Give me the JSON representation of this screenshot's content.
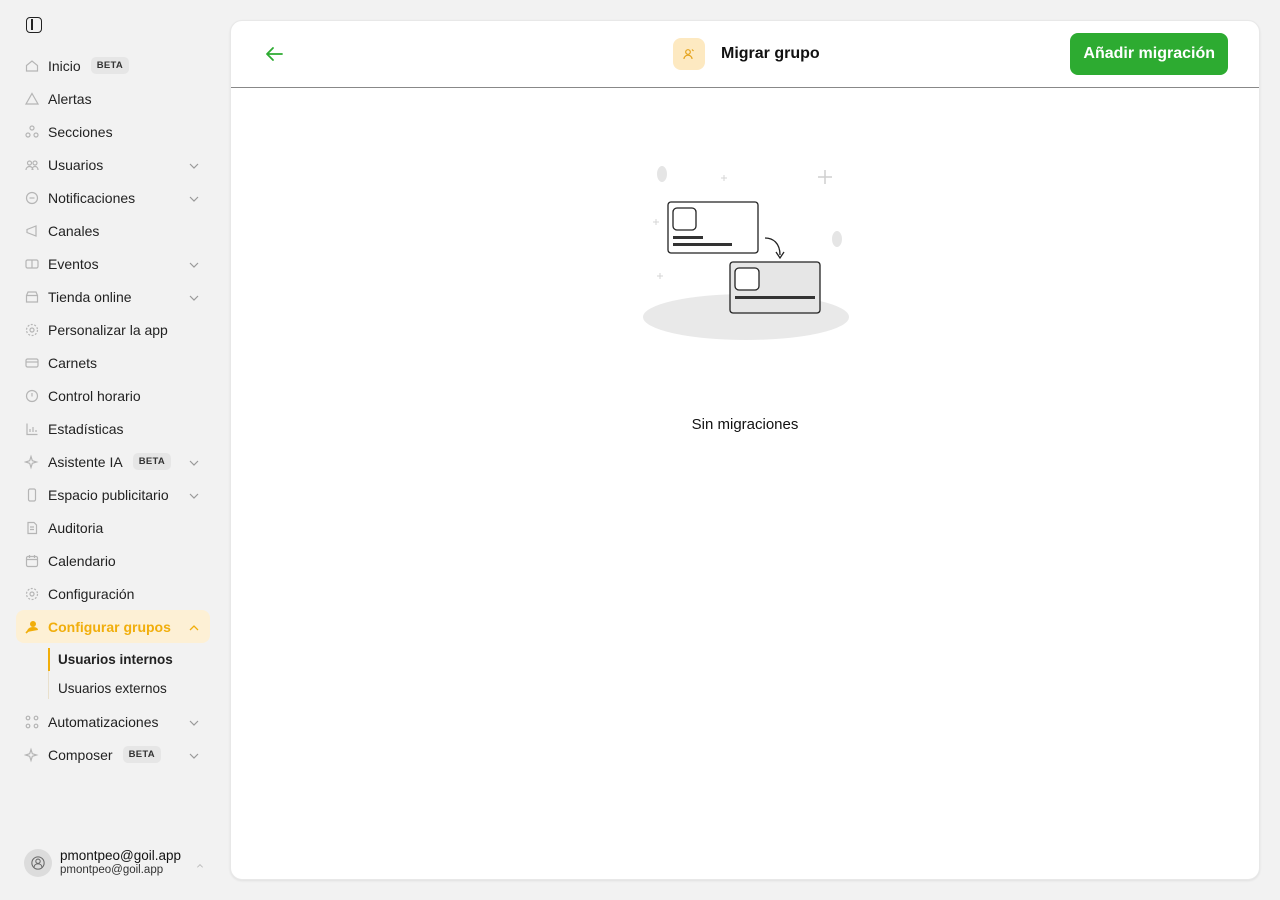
{
  "sidebar": {
    "items": [
      {
        "label": "Inicio",
        "icon": "home-icon",
        "badge": "BETA",
        "chevron": false
      },
      {
        "label": "Alertas",
        "icon": "alert-icon",
        "chevron": false
      },
      {
        "label": "Secciones",
        "icon": "sections-icon",
        "chevron": false
      },
      {
        "label": "Usuarios",
        "icon": "users-icon",
        "chevron": true
      },
      {
        "label": "Notificaciones",
        "icon": "chat-icon",
        "chevron": true
      },
      {
        "label": "Canales",
        "icon": "megaphone-icon",
        "chevron": false
      },
      {
        "label": "Eventos",
        "icon": "ticket-icon",
        "chevron": true
      },
      {
        "label": "Tienda online",
        "icon": "store-icon",
        "chevron": true
      },
      {
        "label": "Personalizar la app",
        "icon": "gear-icon",
        "chevron": false
      },
      {
        "label": "Carnets",
        "icon": "card-icon",
        "chevron": false
      },
      {
        "label": "Control horario",
        "icon": "clock-icon",
        "chevron": false
      },
      {
        "label": "Estadísticas",
        "icon": "chart-icon",
        "chevron": false
      },
      {
        "label": "Asistente IA",
        "icon": "sparkle-icon",
        "badge": "BETA",
        "chevron": true
      },
      {
        "label": "Espacio publicitario",
        "icon": "phone-icon",
        "chevron": true
      },
      {
        "label": "Auditoria",
        "icon": "audit-icon",
        "chevron": false
      },
      {
        "label": "Calendario",
        "icon": "calendar-icon",
        "chevron": false
      },
      {
        "label": "Configuración",
        "icon": "settings-icon",
        "chevron": false
      }
    ],
    "active": {
      "label": "Configurar grupos",
      "icon": "group-pin-icon"
    },
    "subitems": [
      {
        "label": "Usuarios internos",
        "current": true
      },
      {
        "label": "Usuarios externos",
        "current": false
      }
    ],
    "after": [
      {
        "label": "Automatizaciones",
        "icon": "automation-icon",
        "chevron": true
      },
      {
        "label": "Composer",
        "icon": "sparkle-icon",
        "badge": "BETA",
        "chevron": true
      }
    ],
    "user": {
      "name": "pmontpeo@goil.app",
      "email": "pmontpeo@goil.app"
    }
  },
  "header": {
    "title": "Migrar grupo",
    "add_button": "Añadir migración"
  },
  "main": {
    "empty_text": "Sin migraciones"
  },
  "colors": {
    "accent_green": "#2dab31",
    "accent_yellow": "#f1ae0b"
  }
}
